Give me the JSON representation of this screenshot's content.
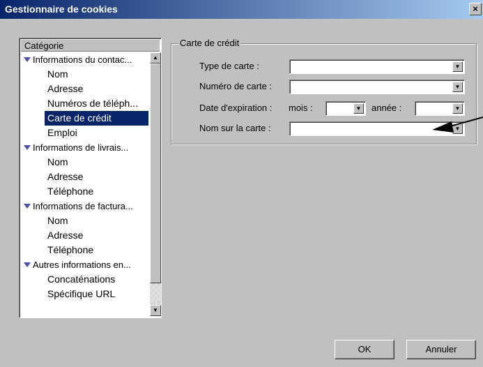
{
  "window": {
    "title": "Gestionnaire de cookies",
    "close_label": "×"
  },
  "tree": {
    "header": "Catégorie",
    "items": [
      {
        "label": "Informations du contac...",
        "kind": "cat"
      },
      {
        "label": "Nom",
        "kind": "sub"
      },
      {
        "label": "Adresse",
        "kind": "sub"
      },
      {
        "label": "Numéros de téléph...",
        "kind": "sub"
      },
      {
        "label": "Carte de crédit",
        "kind": "sub",
        "selected": true
      },
      {
        "label": "Emploi",
        "kind": "sub"
      },
      {
        "label": "Informations de livrais...",
        "kind": "cat"
      },
      {
        "label": "Nom",
        "kind": "sub"
      },
      {
        "label": "Adresse",
        "kind": "sub"
      },
      {
        "label": "Téléphone",
        "kind": "sub"
      },
      {
        "label": "Informations de factura...",
        "kind": "cat"
      },
      {
        "label": "Nom",
        "kind": "sub"
      },
      {
        "label": "Adresse",
        "kind": "sub"
      },
      {
        "label": "Téléphone",
        "kind": "sub"
      },
      {
        "label": "Autres informations en...",
        "kind": "cat"
      },
      {
        "label": "Concaténations",
        "kind": "sub"
      },
      {
        "label": "Spécifique URL",
        "kind": "sub"
      }
    ]
  },
  "form": {
    "group_title": "Carte de crédit",
    "card_type_label": "Type de carte :",
    "card_type_value": "",
    "card_number_label": "Numéro de carte :",
    "card_number_value": "",
    "expiry_label": "Date d'expiration :",
    "month_label": "mois :",
    "month_value": "",
    "year_label": "année :",
    "year_value": "",
    "name_label": "Nom sur la carte :",
    "name_value": ""
  },
  "buttons": {
    "ok": "OK",
    "cancel": "Annuler"
  },
  "colors": {
    "title_start": "#0a246a",
    "title_end": "#a6caf0",
    "selection": "#0a246a",
    "face": "#c0c0c0"
  }
}
